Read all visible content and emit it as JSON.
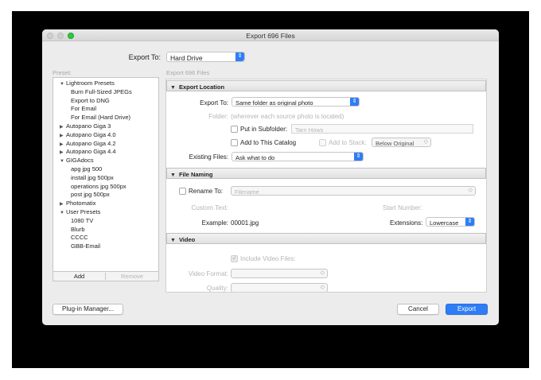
{
  "window": {
    "title": "Export 696 Files"
  },
  "top": {
    "export_to_label": "Export To:",
    "export_to_value": "Hard Drive",
    "preset_label": "Preset:",
    "subheading": "Export 696 Files"
  },
  "presets": {
    "groups": [
      {
        "name": "Lightroom Presets",
        "expanded": true,
        "items": [
          "Burn Full-Sized JPEGs",
          "Export to DNG",
          "For Email",
          "For Email (Hard Drive)"
        ]
      },
      {
        "name": "Autopano Giga 3",
        "expanded": false,
        "items": []
      },
      {
        "name": "Autopano Giga 4.0",
        "expanded": false,
        "items": []
      },
      {
        "name": "Autopano Giga 4.2",
        "expanded": false,
        "items": []
      },
      {
        "name": "Autopano Giga 4.4",
        "expanded": false,
        "items": []
      },
      {
        "name": "GIGAdocs",
        "expanded": true,
        "items": [
          "apg jpg 500",
          "install jpg 500px",
          "operations jpg 500px",
          "post jpg 500px"
        ]
      },
      {
        "name": "Photomatix",
        "expanded": false,
        "items": []
      },
      {
        "name": "User Presets",
        "expanded": true,
        "items": [
          "1080 TV",
          "Blurb",
          "CCCC",
          "GBB-Email"
        ]
      }
    ],
    "add_label": "Add",
    "remove_label": "Remove"
  },
  "export_location": {
    "header": "Export Location",
    "export_to_label": "Export To:",
    "export_to_value": "Same folder as original photo",
    "folder_label": "Folder:",
    "folder_value": "(wherever each source photo is located)",
    "subfolder_label": "Put in Subfolder:",
    "subfolder_value": "Tarn Hows",
    "add_catalog_label": "Add to This Catalog",
    "add_stack_label": "Add to Stack:",
    "stack_value": "Below Original",
    "existing_label": "Existing Files:",
    "existing_value": "Ask what to do"
  },
  "file_naming": {
    "header": "File Naming",
    "rename_label": "Rename To:",
    "rename_value": "Filename",
    "custom_text_label": "Custom Text:",
    "start_number_label": "Start Number:",
    "example_label": "Example:",
    "example_value": "00001.jpg",
    "extensions_label": "Extensions:",
    "extensions_value": "Lowercase"
  },
  "video": {
    "header": "Video",
    "include_label": "Include Video Files:",
    "format_label": "Video Format:",
    "quality_label": "Quality:"
  },
  "footer": {
    "plugin_manager": "Plug-in Manager...",
    "cancel": "Cancel",
    "export": "Export"
  },
  "colors": {
    "accent": "#2f7df6",
    "zoom_button": "#2ec940"
  }
}
